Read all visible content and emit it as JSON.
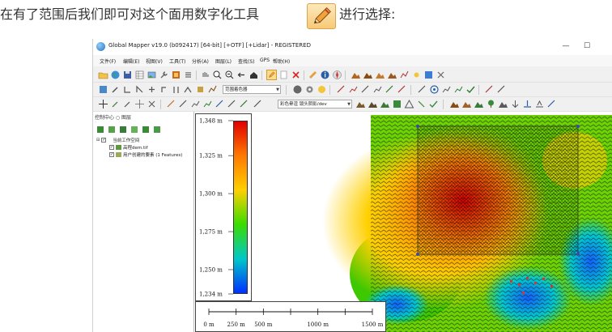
{
  "intro": {
    "before_tool": "在有了范围后我们即可对这个面用数字化工具",
    "after_tool": "进行选择:",
    "tool_icon": "pencil-icon"
  },
  "window": {
    "title": "Global Mapper v19.0 (b092417) [64-bit] [+OTF] [+Lidar] - REGISTERED",
    "minimize": "—",
    "maximize": "☐"
  },
  "menu": [
    "文件(F)",
    "编辑(E)",
    "视图(V)",
    "工具(T)",
    "分析(A)",
    "图层(L)",
    "查找(S)",
    "GPS",
    "帮助(H)"
  ],
  "toolbars": {
    "layer_combo": "范围着色器",
    "shader_combo": "彩色晕渲 镜头阴影/dev"
  },
  "panel": {
    "title": "控制中心 ○ 图层",
    "tree": {
      "root": "当前工作空间",
      "layer1": "高程dem.tif",
      "layer2": "用户创建的要素 (1 Features)"
    }
  },
  "legend": {
    "labels": [
      "1,348 m",
      "1,325 m",
      "1,300 m",
      "1,275 m",
      "1,250 m",
      "1,234 m"
    ],
    "label_values": [
      1348,
      1325,
      1300,
      1275,
      1250,
      1234
    ],
    "max": 1348,
    "min": 1234,
    "colors": [
      "#e00000",
      "#ff7a00",
      "#ffd000",
      "#3bdc00",
      "#00c8c8",
      "#0030ff"
    ]
  },
  "scalebar": {
    "labels": [
      "0 m",
      "250 m",
      "500 m",
      "1000 m",
      "1500 m"
    ],
    "values": [
      0,
      250,
      500,
      1000,
      1500
    ],
    "max": 1500
  }
}
